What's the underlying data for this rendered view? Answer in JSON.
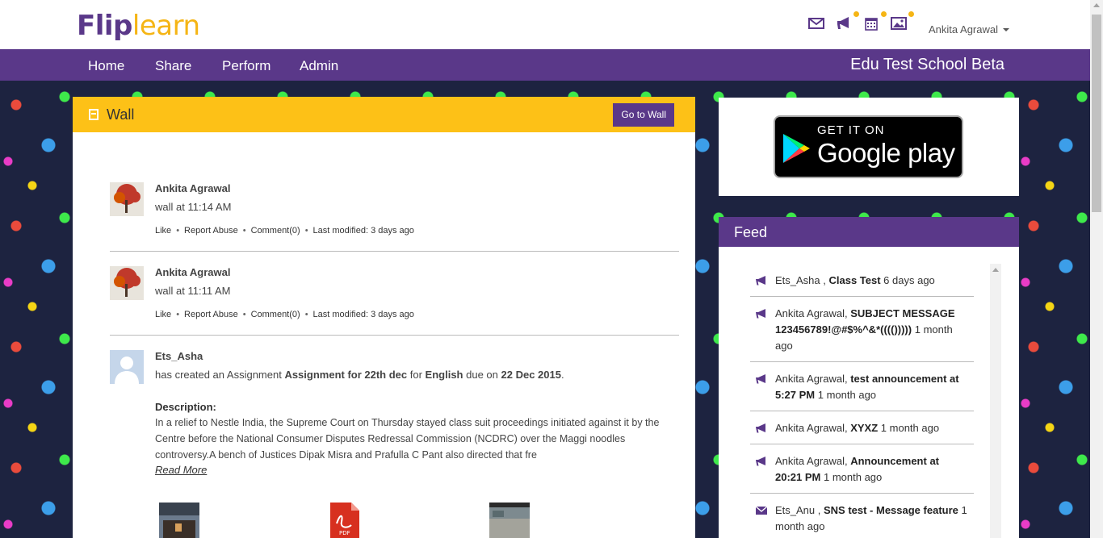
{
  "brand": {
    "part1": "Flip",
    "part2": "learn",
    "color": "#5a3889",
    "accent": "#f5b515"
  },
  "header": {
    "icons": [
      "envelope-icon",
      "megaphone-icon",
      "calendar-icon",
      "image-icon"
    ],
    "user_name": "Ankita Agrawal"
  },
  "nav": {
    "items": [
      {
        "label": "Home"
      },
      {
        "label": "Share"
      },
      {
        "label": "Perform"
      },
      {
        "label": "Admin"
      }
    ],
    "school_name": "Edu Test School Beta"
  },
  "wall": {
    "title": "Wall",
    "goto_label": "Go to Wall",
    "posts": [
      {
        "author": "Ankita Agrawal",
        "text": "wall at 11:14 AM",
        "like": "Like",
        "report": "Report Abuse",
        "comment": "Comment(0)",
        "modified": "Last modified: 3 days ago"
      },
      {
        "author": "Ankita Agrawal",
        "text": "wall at 11:11 AM",
        "like": "Like",
        "report": "Report Abuse",
        "comment": "Comment(0)",
        "modified": "Last modified: 3 days ago"
      },
      {
        "author": "Ets_Asha",
        "text_pre": "has created an Assignment ",
        "assignment": "Assignment for 22th dec",
        "text_mid": " for ",
        "subject": "English",
        "text_mid2": " due on ",
        "due": "22 Dec 2015",
        "text_end": ".",
        "desc_label": "Description:",
        "desc": "In a relief to Nestle India, the Supreme Court on Thursday stayed class suit proceedings initiated against it by the Centre before the National Consumer Disputes Redressal Commission (NCDRC) over the Maggi noodles controversy.A bench of Justices Dipak Misra and Prafulla C Pant also directed that fre",
        "read_more": "Read More"
      }
    ]
  },
  "google_play": {
    "get_it_on": "GET IT ON",
    "name": "Google play"
  },
  "feed": {
    "title": "Feed",
    "items": [
      {
        "icon": "megaphone-icon",
        "who": "Ets_Asha , ",
        "what": "Class Test",
        "when": " 6 days ago"
      },
      {
        "icon": "megaphone-icon",
        "who": "Ankita Agrawal, ",
        "what": "SUBJECT MESSAGE 123456789!@#$%^&*(((()))))",
        "when": " 1 month ago"
      },
      {
        "icon": "megaphone-icon",
        "who": "Ankita Agrawal, ",
        "what": "test announcement at 5:27 PM",
        "when": " 1 month ago"
      },
      {
        "icon": "megaphone-icon",
        "who": "Ankita Agrawal, ",
        "what": "XYXZ",
        "when": " 1 month ago"
      },
      {
        "icon": "megaphone-icon",
        "who": "Ankita Agrawal, ",
        "what": "Announcement at 20:21 PM",
        "when": " 1 month ago"
      },
      {
        "icon": "envelope-icon",
        "who": "Ets_Anu , ",
        "what": "SNS test - Message feature",
        "when": " 1 month ago"
      }
    ]
  }
}
